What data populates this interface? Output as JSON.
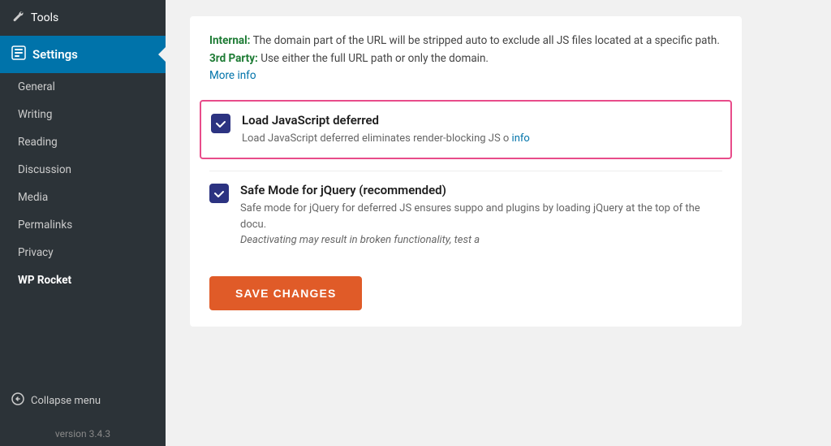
{
  "sidebar": {
    "tools_label": "Tools",
    "settings_label": "Settings",
    "submenu": [
      {
        "label": "General",
        "active": false
      },
      {
        "label": "Writing",
        "active": false
      },
      {
        "label": "Reading",
        "active": false
      },
      {
        "label": "Discussion",
        "active": false
      },
      {
        "label": "Media",
        "active": false
      },
      {
        "label": "Permalinks",
        "active": false
      },
      {
        "label": "Privacy",
        "active": false
      },
      {
        "label": "WP Rocket",
        "active": true
      }
    ],
    "collapse_label": "Collapse menu"
  },
  "info": {
    "internal_label": "Internal:",
    "internal_text": " The domain part of the URL will be stripped auto to exclude all JS files located at a specific path.",
    "thirdparty_label": "3rd Party:",
    "thirdparty_text": " Use either the full URL path or only the domain.",
    "more_info_link": "More info"
  },
  "options": [
    {
      "id": "load-js-deferred",
      "title": "Load JavaScript deferred",
      "desc": "Load JavaScript deferred eliminates render-blocking JS o",
      "desc_link": "info",
      "checked": true,
      "highlighted": true
    },
    {
      "id": "safe-mode-jquery",
      "title": "Safe Mode for jQuery (recommended)",
      "desc": "Safe mode for jQuery for deferred JS ensures suppo and plugins by loading jQuery at the top of the docu.",
      "desc_italic": "Deactivating may result in broken functionality, test a",
      "checked": true,
      "highlighted": false
    }
  ],
  "save_button_label": "SAVE CHANGES",
  "version": "version 3.4.3",
  "colors": {
    "active_bg": "#0073aa",
    "checkbox_bg": "#2c3381",
    "save_btn": "#e05b28",
    "highlight_border": "#e84c8a",
    "link": "#0073aa",
    "green": "#1d7b34"
  }
}
